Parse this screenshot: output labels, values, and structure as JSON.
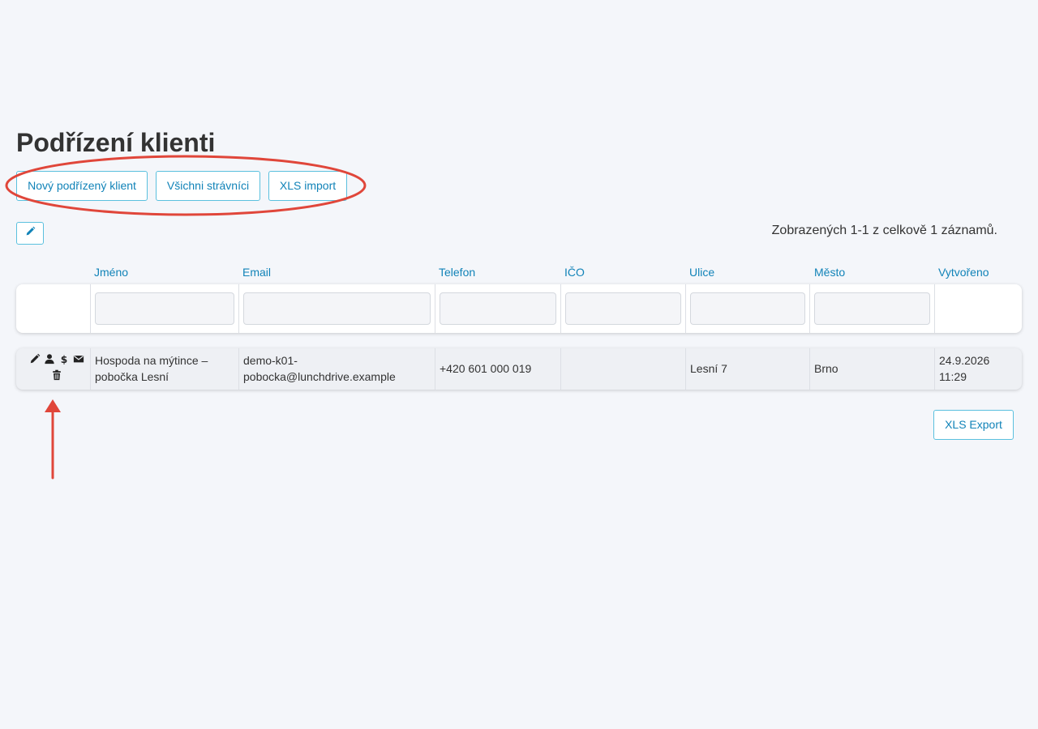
{
  "page": {
    "title": "Podřízení klienti"
  },
  "toolbar": {
    "new_client_label": "Nový podřízený klient",
    "all_diners_label": "Všichni strávníci",
    "xls_import_label": "XLS import"
  },
  "summary": {
    "text": "Zobrazených 1-1 z celkově 1 záznamů."
  },
  "table": {
    "headers": [
      "Jméno",
      "Email",
      "Telefon",
      "IČO",
      "Ulice",
      "Město",
      "Vytvořeno"
    ],
    "rows": [
      {
        "name_line1": "Hospoda na mýtince –",
        "name_line2": "pobočka Lesní",
        "email_line1": "demo-k01-",
        "email_line2": "pobocka@lunchdrive.example",
        "phone": "+420 601 000 019",
        "ico": "",
        "street": "Lesní 7",
        "city": "Brno",
        "created_line1": "24.9.2026",
        "created_line2": "11:29"
      }
    ],
    "row_action_icons": [
      "pencil-icon",
      "user-icon",
      "dollar-icon",
      "envelope-icon",
      "trash-icon"
    ]
  },
  "export": {
    "xls_export_label": "XLS Export"
  },
  "colors": {
    "accent_link": "#1183b8",
    "button_border": "#5bc0de",
    "annotation_red": "#e0463a",
    "background": "#f4f6fa"
  }
}
